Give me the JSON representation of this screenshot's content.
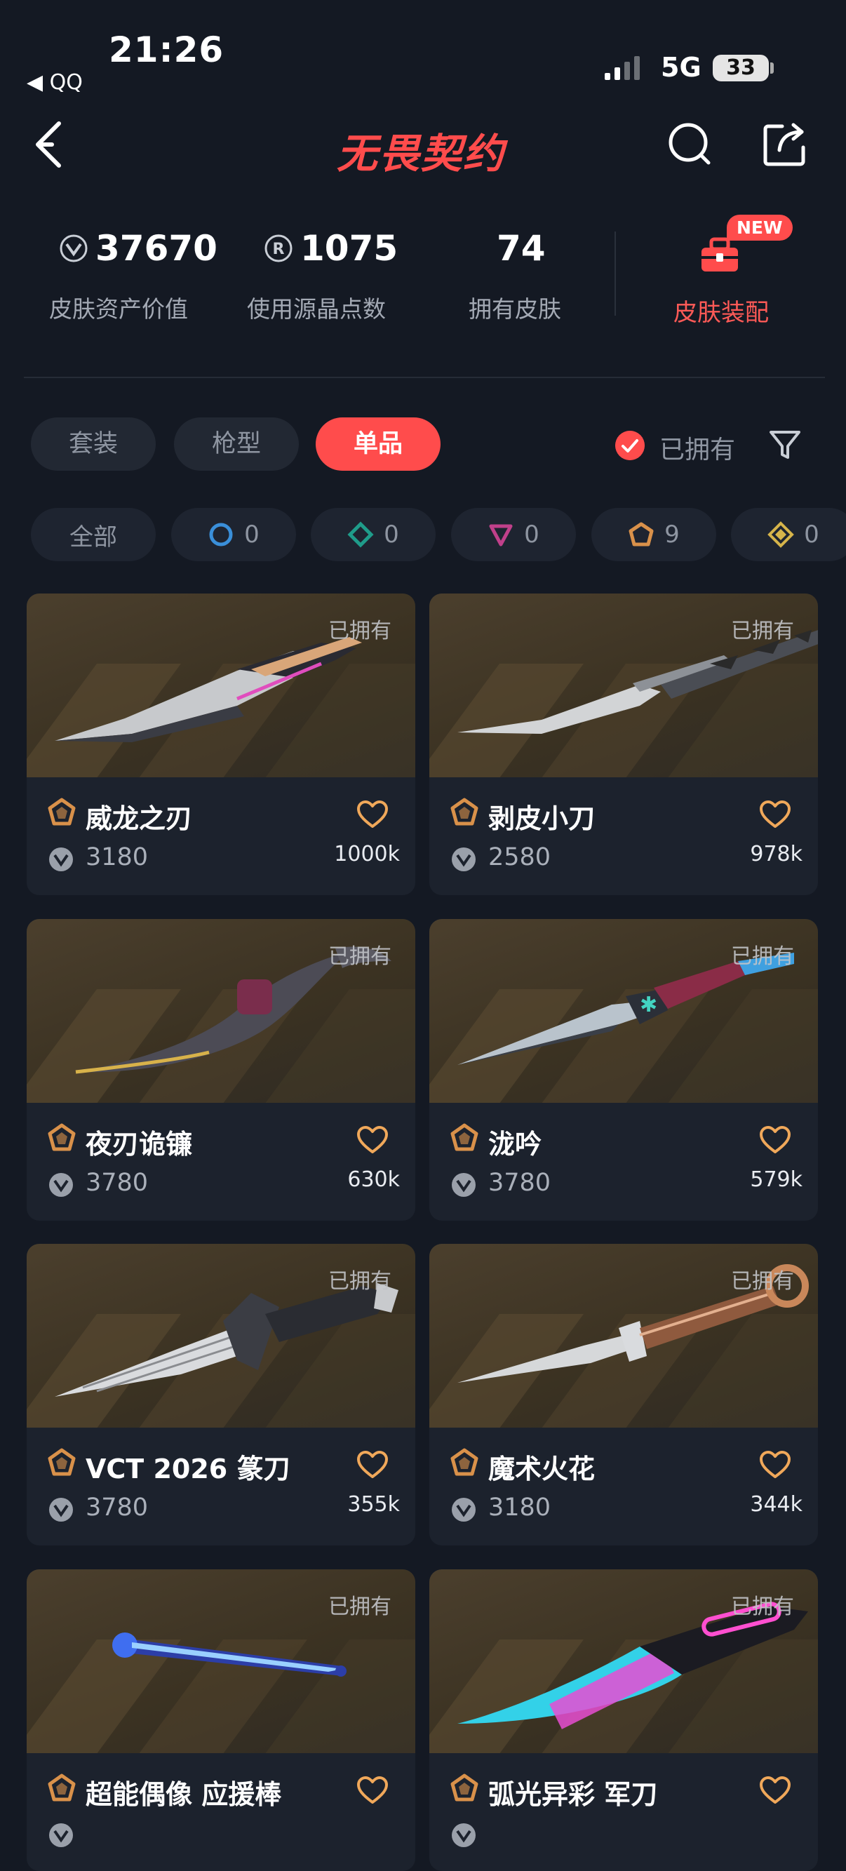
{
  "status_bar": {
    "time": "21:26",
    "back_app": "◀ QQ",
    "network": "5G",
    "battery": "33"
  },
  "header": {
    "title": "无畏契约"
  },
  "stats": [
    {
      "value": "37670",
      "label": "皮肤资产价值",
      "icon": "vp-coin-icon"
    },
    {
      "value": "1075",
      "label": "使用源晶点数",
      "icon": "radianite-icon"
    },
    {
      "value": "74",
      "label": "拥有皮肤"
    }
  ],
  "equip": {
    "label": "皮肤装配",
    "badge": "NEW"
  },
  "tabs": [
    "套装",
    "枪型",
    "单品"
  ],
  "active_tab": "单品",
  "owned_filter": {
    "label": "已拥有",
    "checked": true
  },
  "rarity_chips": [
    {
      "label": "全部"
    },
    {
      "count": "0",
      "icon": "select-tier-icon",
      "color": "#3a8fd9"
    },
    {
      "count": "0",
      "icon": "deluxe-tier-icon",
      "color": "#1f9c8a"
    },
    {
      "count": "0",
      "icon": "premium-tier-icon",
      "color": "#c0408a"
    },
    {
      "count": "9",
      "icon": "exclusive-tier-icon",
      "color": "#d9914a"
    },
    {
      "count": "0",
      "icon": "ultra-tier-icon",
      "color": "#d6b44a"
    }
  ],
  "items": [
    {
      "name": "威龙之刃",
      "price": "3180",
      "likes": "1000k",
      "owned": "已拥有"
    },
    {
      "name": "剥皮小刀",
      "price": "2580",
      "likes": "978k",
      "owned": "已拥有"
    },
    {
      "name": "夜刃诡镰",
      "price": "3780",
      "likes": "630k",
      "owned": "已拥有"
    },
    {
      "name": "泷吟",
      "price": "3780",
      "likes": "579k",
      "owned": "已拥有"
    },
    {
      "name": "VCT 2026 篆刀",
      "price": "3780",
      "likes": "355k",
      "owned": "已拥有"
    },
    {
      "name": "魔术火花",
      "price": "3180",
      "likes": "344k",
      "owned": "已拥有"
    },
    {
      "name": "超能偶像 应援棒",
      "price": "",
      "likes": "",
      "owned": "已拥有"
    },
    {
      "name": "弧光异彩 军刀",
      "price": "",
      "likes": "",
      "owned": "已拥有"
    }
  ],
  "colors": {
    "accent": "#ff4c4c",
    "tier_exclusive": "#d9914a",
    "background": "#141923"
  }
}
